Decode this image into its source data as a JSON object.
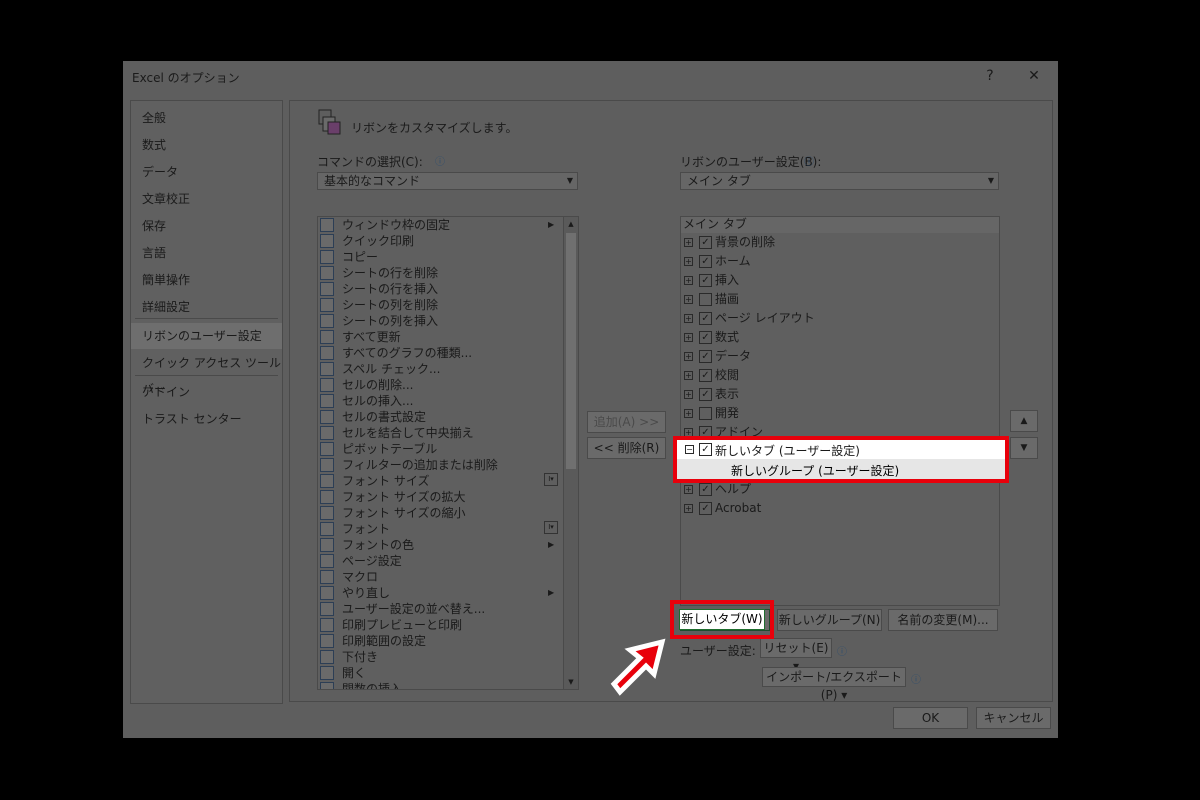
{
  "window": {
    "title": "Excel のオプション",
    "help": "?",
    "close": "✕"
  },
  "nav": {
    "items": [
      "全般",
      "数式",
      "データ",
      "文章校正",
      "保存",
      "言語",
      "簡単操作",
      "詳細設定",
      "リボンのユーザー設定",
      "クイック アクセス ツール バー",
      "アドイン",
      "トラスト センター"
    ],
    "selected": "リボンのユーザー設定"
  },
  "header": {
    "title": "リボンをカスタマイズします。"
  },
  "left": {
    "label": "コマンドの選択(C):",
    "combo": "基本的なコマンド",
    "commands": [
      "ウィンドウ枠の固定",
      "クイック印刷",
      "コピー",
      "シートの行を削除",
      "シートの行を挿入",
      "シートの列を削除",
      "シートの列を挿入",
      "すべて更新",
      "すべてのグラフの種類...",
      "スペル チェック...",
      "セルの削除...",
      "セルの挿入...",
      "セルの書式設定",
      "セルを結合して中央揃え",
      "ピボットテーブル",
      "フィルターの追加または削除",
      "フォント サイズ",
      "フォント サイズの拡大",
      "フォント サイズの縮小",
      "フォント",
      "フォントの色",
      "ページ設定",
      "マクロ",
      "やり直し",
      "ユーザー設定の並べ替え...",
      "印刷プレビューと印刷",
      "印刷範囲の設定",
      "下付き",
      "開く",
      "関数の挿入"
    ]
  },
  "middle": {
    "add": "追加(A) >>",
    "remove": "<< 削除(R)"
  },
  "right": {
    "label": "リボンのユーザー設定(B):",
    "combo": "メイン タブ",
    "tree_header": "メイン タブ",
    "tree": [
      {
        "label": "背景の削除",
        "checked": true,
        "sign": "+"
      },
      {
        "label": "ホーム",
        "checked": true,
        "sign": "+"
      },
      {
        "label": "挿入",
        "checked": true,
        "sign": "+"
      },
      {
        "label": "描画",
        "checked": false,
        "sign": "+"
      },
      {
        "label": "ページ レイアウト",
        "checked": true,
        "sign": "+"
      },
      {
        "label": "数式",
        "checked": true,
        "sign": "+"
      },
      {
        "label": "データ",
        "checked": true,
        "sign": "+"
      },
      {
        "label": "校閲",
        "checked": true,
        "sign": "+"
      },
      {
        "label": "表示",
        "checked": true,
        "sign": "+"
      },
      {
        "label": "開発",
        "checked": false,
        "sign": "+"
      },
      {
        "label": "アドイン",
        "checked": true,
        "sign": "+"
      },
      {
        "label": "新しいタブ (ユーザー設定)",
        "checked": true,
        "sign": "-"
      },
      {
        "label": "新しいグループ (ユーザー設定)",
        "checked": null,
        "sign": ""
      },
      {
        "label": "ヘルプ",
        "checked": true,
        "sign": "+"
      },
      {
        "label": "Acrobat",
        "checked": true,
        "sign": "+"
      }
    ],
    "new_tab": "新しいタブ(W)",
    "new_group": "新しいグループ(N)",
    "rename": "名前の変更(M)...",
    "customize_label": "ユーザー設定:",
    "reset": "リセット(E) ▾",
    "import_export": "インポート/エクスポート(P) ▾"
  },
  "footer": {
    "ok": "OK",
    "cancel": "キャンセル"
  },
  "colors": {
    "highlight": "#e8000b",
    "dim_bg": "#5e5e5e"
  }
}
